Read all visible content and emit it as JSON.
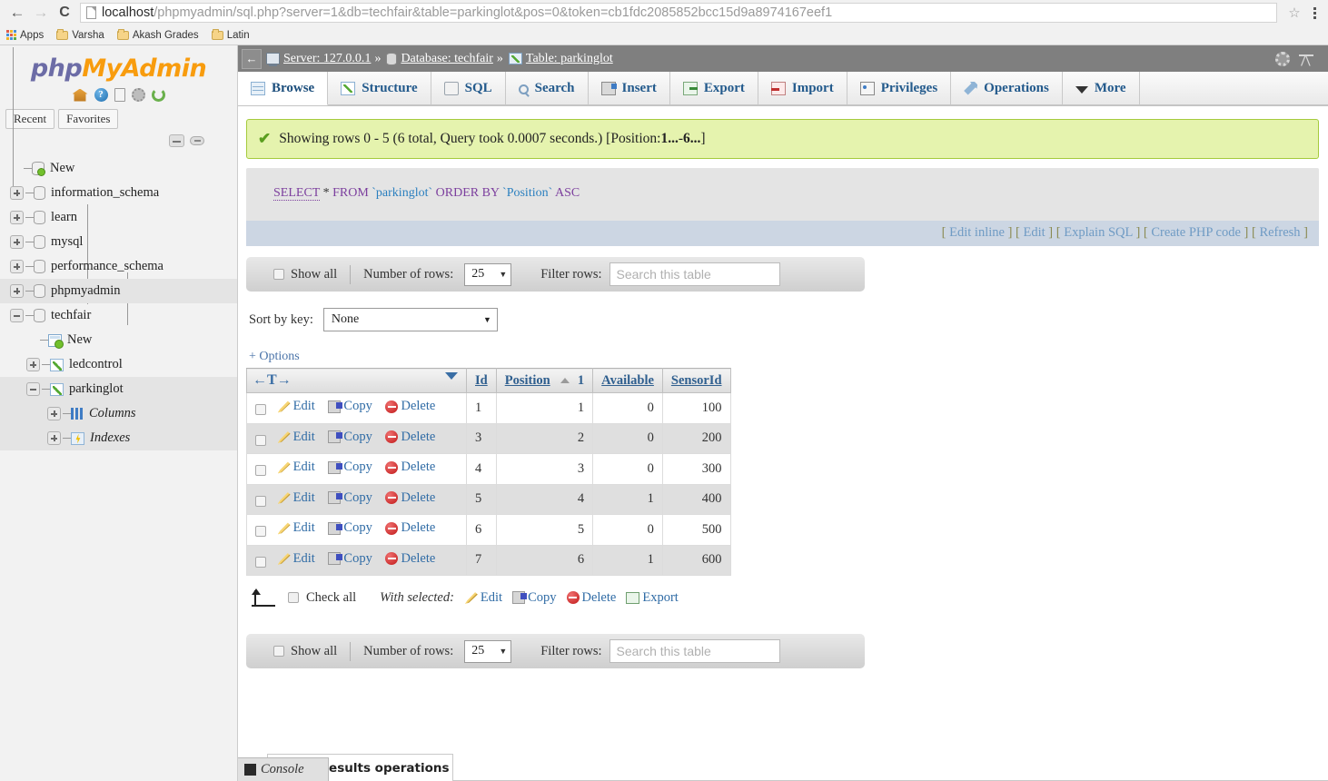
{
  "browser": {
    "url_host": "localhost",
    "url_path": "/phpmyadmin/sql.php?server=1&db=techfair&table=parkinglot&pos=0&token=cb1fdc2085852bcc15d9a8974167eef1",
    "back_icon": "←",
    "forward_icon": "→",
    "reload_icon": "C",
    "star_icon": "☆",
    "bookmarks": [
      {
        "label": "Apps",
        "icon": "apps-grid-icon"
      },
      {
        "label": "Varsha",
        "icon": "folder-icon"
      },
      {
        "label": "Akash Grades",
        "icon": "folder-icon"
      },
      {
        "label": "Latin",
        "icon": "folder-icon"
      }
    ]
  },
  "sidebar": {
    "logo_php": "php",
    "logo_my": "My",
    "logo_admin": "Admin",
    "logo_icons": [
      "home-icon",
      "help-icon",
      "documentation-icon",
      "settings-icon",
      "reload-icon"
    ],
    "recent_label": "Recent",
    "favorites_label": "Favorites",
    "tree": [
      {
        "label": "New",
        "icon": "new-database-icon",
        "expander": "none",
        "indent": 22,
        "highlight": false,
        "italic": false
      },
      {
        "label": "information_schema",
        "icon": "database-icon",
        "expander": "plus",
        "indent": 0,
        "highlight": false,
        "italic": false
      },
      {
        "label": "learn",
        "icon": "database-icon",
        "expander": "plus",
        "indent": 0,
        "highlight": false,
        "italic": false
      },
      {
        "label": "mysql",
        "icon": "database-icon",
        "expander": "plus",
        "indent": 0,
        "highlight": false,
        "italic": false
      },
      {
        "label": "performance_schema",
        "icon": "database-icon",
        "expander": "plus",
        "indent": 0,
        "highlight": false,
        "italic": false
      },
      {
        "label": "phpmyadmin",
        "icon": "database-icon",
        "expander": "plus",
        "indent": 0,
        "highlight": true,
        "italic": false
      },
      {
        "label": "techfair",
        "icon": "database-icon",
        "expander": "minus",
        "indent": 0,
        "highlight": false,
        "italic": false
      },
      {
        "label": "New",
        "icon": "new-table-icon",
        "expander": "none",
        "indent": 40,
        "highlight": false,
        "italic": false
      },
      {
        "label": "ledcontrol",
        "icon": "table-icon",
        "expander": "plus",
        "indent": 18,
        "highlight": false,
        "italic": false
      },
      {
        "label": "parkinglot",
        "icon": "table-icon",
        "expander": "minus",
        "indent": 18,
        "highlight": true,
        "italic": false
      },
      {
        "label": "Columns",
        "icon": "columns-icon",
        "expander": "plus",
        "indent": 40,
        "highlight": true,
        "italic": true
      },
      {
        "label": "Indexes",
        "icon": "indexes-icon",
        "expander": "plus",
        "indent": 40,
        "highlight": true,
        "italic": true
      }
    ]
  },
  "breadcrumb": {
    "back_icon": "←",
    "server_label": "Server: 127.0.0.1",
    "database_label": "Database: techfair",
    "table_label": "Table: parkinglot",
    "separator": "»",
    "gear_icon": "gear-icon",
    "collapse_icon": "collapse-icon"
  },
  "tabs": [
    {
      "label": "Browse",
      "icon": "browse-icon",
      "active": true
    },
    {
      "label": "Structure",
      "icon": "structure-icon",
      "active": false
    },
    {
      "label": "SQL",
      "icon": "sql-icon",
      "active": false
    },
    {
      "label": "Search",
      "icon": "search-icon",
      "active": false
    },
    {
      "label": "Insert",
      "icon": "insert-icon",
      "active": false
    },
    {
      "label": "Export",
      "icon": "export-icon",
      "active": false
    },
    {
      "label": "Import",
      "icon": "import-icon",
      "active": false
    },
    {
      "label": "Privileges",
      "icon": "privileges-icon",
      "active": false
    },
    {
      "label": "Operations",
      "icon": "operations-icon",
      "active": false
    },
    {
      "label": "More",
      "icon": "chevron-down-icon",
      "active": false
    }
  ],
  "status": {
    "check_icon": "✔",
    "text_1": "Showing rows 0 - 5 (6 total, Query took 0.0007 seconds.) [Position: ",
    "bold_1": "1...",
    "dash": " - ",
    "bold_2": "6...",
    "text_2": "]"
  },
  "sql": {
    "keyword_select": "SELECT",
    "star": " * ",
    "keyword_from": "FROM",
    "table_name": " `parkinglot` ",
    "keyword_orderby": "ORDER BY",
    "column_name": " `Position` ",
    "keyword_asc": "ASC",
    "actions": [
      "Edit inline",
      "Edit",
      "Explain SQL",
      "Create PHP code",
      "Refresh"
    ]
  },
  "controls": {
    "show_all_label": "Show all",
    "number_of_rows_label": "Number of rows:",
    "rows_value": "25",
    "filter_rows_label": "Filter rows:",
    "filter_placeholder": "Search this table",
    "sort_by_key_label": "Sort by key:",
    "sort_by_key_value": "None",
    "options_label": "+ Options"
  },
  "table": {
    "nav_arrows": "←T→",
    "columns": [
      "Id",
      "Position",
      "Available",
      "SensorId"
    ],
    "sorted_column": "Position",
    "sort_direction_icon": "sort-asc-icon",
    "sort_order_number": "1",
    "row_actions": [
      "Edit",
      "Copy",
      "Delete"
    ],
    "rows": [
      {
        "Id": "1",
        "Position": "1",
        "Available": "0",
        "SensorId": "100"
      },
      {
        "Id": "3",
        "Position": "2",
        "Available": "0",
        "SensorId": "200"
      },
      {
        "Id": "4",
        "Position": "3",
        "Available": "0",
        "SensorId": "300"
      },
      {
        "Id": "5",
        "Position": "4",
        "Available": "1",
        "SensorId": "400"
      },
      {
        "Id": "6",
        "Position": "5",
        "Available": "0",
        "SensorId": "500"
      },
      {
        "Id": "7",
        "Position": "6",
        "Available": "1",
        "SensorId": "600"
      }
    ]
  },
  "bottom": {
    "check_all_label": "Check all",
    "with_selected_label": "With selected:",
    "actions": [
      "Edit",
      "Copy",
      "Delete",
      "Export"
    ]
  },
  "footer": {
    "query_results_operations": "Query results operations",
    "console_label": "Console"
  }
}
